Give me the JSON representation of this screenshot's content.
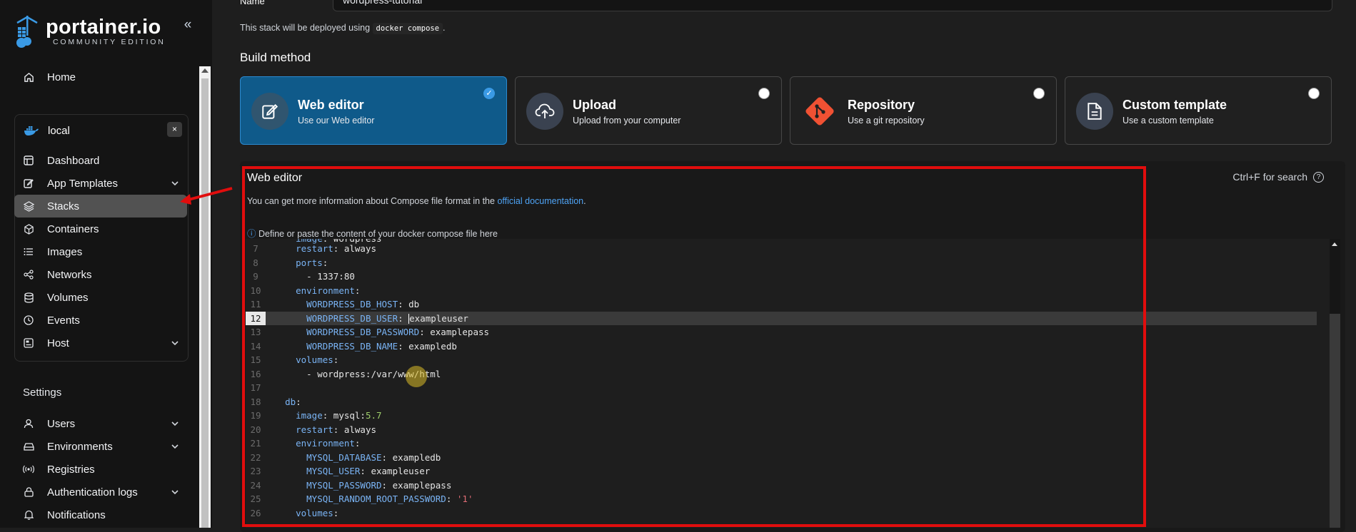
{
  "brand": {
    "name": "portainer.io",
    "edition": "COMMUNITY EDITION"
  },
  "sidebar": {
    "collapse_icon": "«",
    "home": "Home",
    "environment": {
      "name": "local",
      "close": "×"
    },
    "env_items": [
      {
        "label": "Dashboard",
        "icon": "dashboard-icon"
      },
      {
        "label": "App Templates",
        "icon": "edit-icon",
        "chevron": true
      },
      {
        "label": "Stacks",
        "icon": "layers-icon",
        "active": true
      },
      {
        "label": "Containers",
        "icon": "box-icon"
      },
      {
        "label": "Images",
        "icon": "list-icon"
      },
      {
        "label": "Networks",
        "icon": "share-icon"
      },
      {
        "label": "Volumes",
        "icon": "database-icon"
      },
      {
        "label": "Events",
        "icon": "clock-icon"
      },
      {
        "label": "Host",
        "icon": "server-icon",
        "chevron": true
      }
    ],
    "settings_title": "Settings",
    "settings_items": [
      {
        "label": "Users",
        "icon": "user-icon",
        "chevron": true
      },
      {
        "label": "Environments",
        "icon": "hdd-icon",
        "chevron": true
      },
      {
        "label": "Registries",
        "icon": "radio-icon"
      },
      {
        "label": "Authentication logs",
        "icon": "lock-icon",
        "chevron": true
      },
      {
        "label": "Notifications",
        "icon": "bell-icon"
      }
    ]
  },
  "form": {
    "name_label": "Name",
    "name_value": "wordpress-tutorial",
    "deploy_note_pre": "This stack will be deployed using",
    "deploy_note_code": "docker compose",
    "deploy_note_post": ".",
    "build_method_title": "Build method"
  },
  "build_methods": [
    {
      "title": "Web editor",
      "subtitle": "Use our Web editor",
      "selected": true
    },
    {
      "title": "Upload",
      "subtitle": "Upload from your computer",
      "selected": false
    },
    {
      "title": "Repository",
      "subtitle": "Use a git repository",
      "selected": false
    },
    {
      "title": "Custom template",
      "subtitle": "Use a custom template",
      "selected": false
    }
  ],
  "editor": {
    "title": "Web editor",
    "search_hint": "Ctrl+F for search",
    "info_pre": "You can get more information about Compose file format in the",
    "info_link": "official documentation",
    "info_post": ".",
    "define_text": "Define or paste the content of your docker compose file here",
    "highlighted_line": 12
  },
  "colors": {
    "accent": "#0f5a8a",
    "active_nav": "#525252",
    "link": "#4ea3f5",
    "annotation_red": "#e10d0d"
  }
}
